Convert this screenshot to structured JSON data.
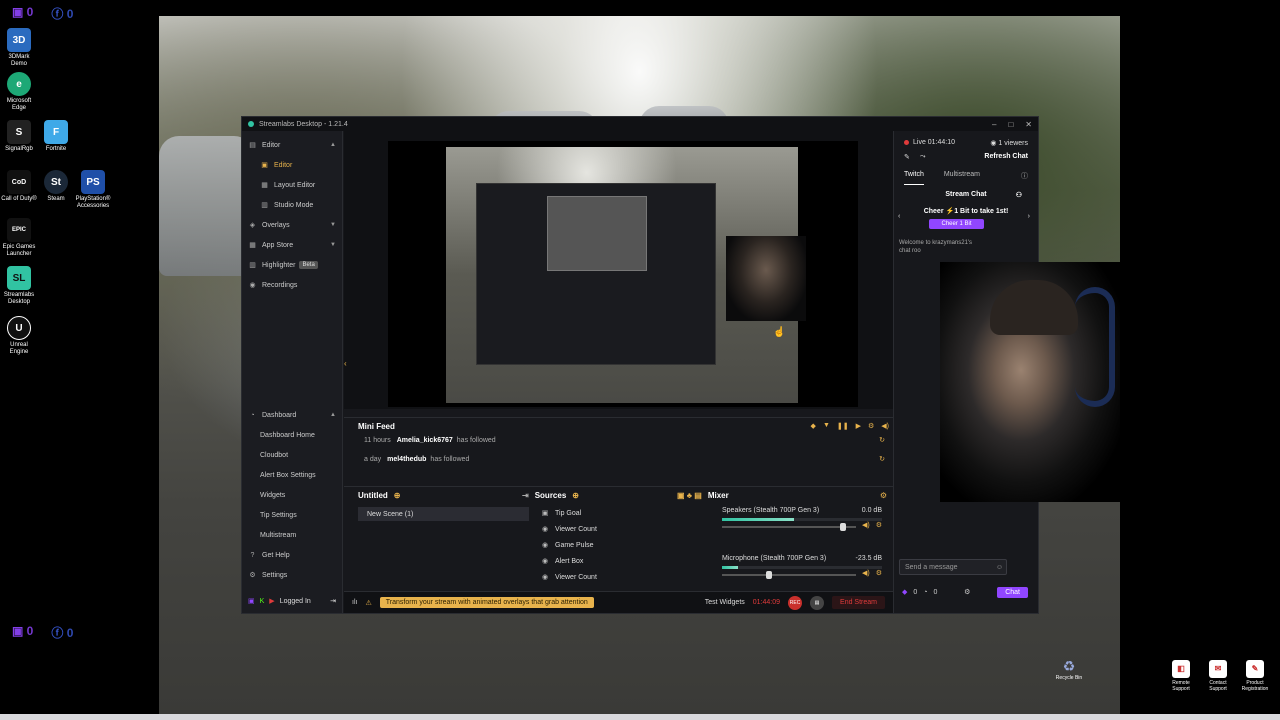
{
  "social_top": {
    "twitch": "0",
    "facebook": "0"
  },
  "social_bottom": {
    "twitch": "0",
    "facebook": "0"
  },
  "desktop_icons": [
    {
      "label": "3DMark Demo",
      "glyph": "3D"
    },
    {
      "label": "Microsoft Edge",
      "glyph": "e"
    },
    {
      "label": "SignalRgb",
      "glyph": "S"
    },
    {
      "label": "Fortnite",
      "glyph": "F"
    },
    {
      "label": "Call of Duty®",
      "glyph": "CoD"
    },
    {
      "label": "Steam",
      "glyph": "St"
    },
    {
      "label": "PlayStation® Accessories",
      "glyph": "PS"
    },
    {
      "label": "Epic Games Launcher",
      "glyph": "EPIC"
    },
    {
      "label": "Streamlabs Desktop",
      "glyph": "SL"
    },
    {
      "label": "Unreal Engine",
      "glyph": "U"
    }
  ],
  "window": {
    "title": "Streamlabs Desktop - 1.21.4"
  },
  "sidebar": {
    "editor": "Editor",
    "editor_sub": "Editor",
    "layout_editor": "Layout Editor",
    "studio_mode": "Studio Mode",
    "overlays": "Overlays",
    "app_store": "App Store",
    "highlighter": "Highlighter",
    "beta": "Beta",
    "recordings": "Recordings",
    "dashboard": "Dashboard",
    "dashboard_home": "Dashboard Home",
    "cloudbot": "Cloudbot",
    "alert_box_settings": "Alert Box Settings",
    "widgets": "Widgets",
    "tip_settings": "Tip Settings",
    "multistream": "Multistream",
    "get_help": "Get Help",
    "settings": "Settings",
    "logged_in": "Logged In"
  },
  "minifeed": {
    "title": "Mini Feed",
    "rows": [
      {
        "time": "11 hours",
        "user": "Amelia_kick6767",
        "action": "has followed"
      },
      {
        "time": "a day",
        "user": "mel4thedub",
        "action": "has followed"
      }
    ]
  },
  "scenes": {
    "title": "Untitled",
    "items": [
      "New Scene (1)"
    ]
  },
  "sources": {
    "title": "Sources",
    "items": [
      "Tip Goal",
      "Viewer Count",
      "Game Pulse",
      "Alert Box",
      "Viewer Count"
    ]
  },
  "mixer": {
    "title": "Mixer",
    "channels": [
      {
        "name": "Speakers (Stealth 700P Gen 3)",
        "db": "0.0 dB",
        "level": 0.45,
        "volume": 0.9
      },
      {
        "name": "Microphone (Stealth 700P Gen 3)",
        "db": "-23.5 dB",
        "level": 0.1,
        "volume": 0.35
      }
    ]
  },
  "footer": {
    "promo": "Transform your stream with animated overlays that grab attention",
    "test_widgets": "Test Widgets",
    "timer": "01:44:09",
    "end_stream": "End Stream"
  },
  "chat": {
    "live": "Live 01:44:10",
    "viewers": "1 viewers",
    "refresh": "Refresh Chat",
    "tab_twitch": "Twitch",
    "tab_multistream": "Multistream",
    "stream_chat": "Stream Chat",
    "cheer": "Cheer ⚡1 Bit to take 1st!",
    "cheer_button": "Cheer 1 Bit",
    "welcome": "Welcome to krazymans21's chat roo",
    "input_placeholder": "Send a message",
    "points_a": "0",
    "points_b": "0",
    "send": "Chat"
  },
  "corner_icons": [
    {
      "label": "Remote Support"
    },
    {
      "label": "Contact Support"
    },
    {
      "label": "Product Registration"
    }
  ],
  "recycle_bin": "Recycle Bin",
  "colors": {
    "accent": "#31c3a2",
    "twitch": "#9146ff",
    "live": "#e03b3b",
    "highlight": "#e8b34c"
  }
}
